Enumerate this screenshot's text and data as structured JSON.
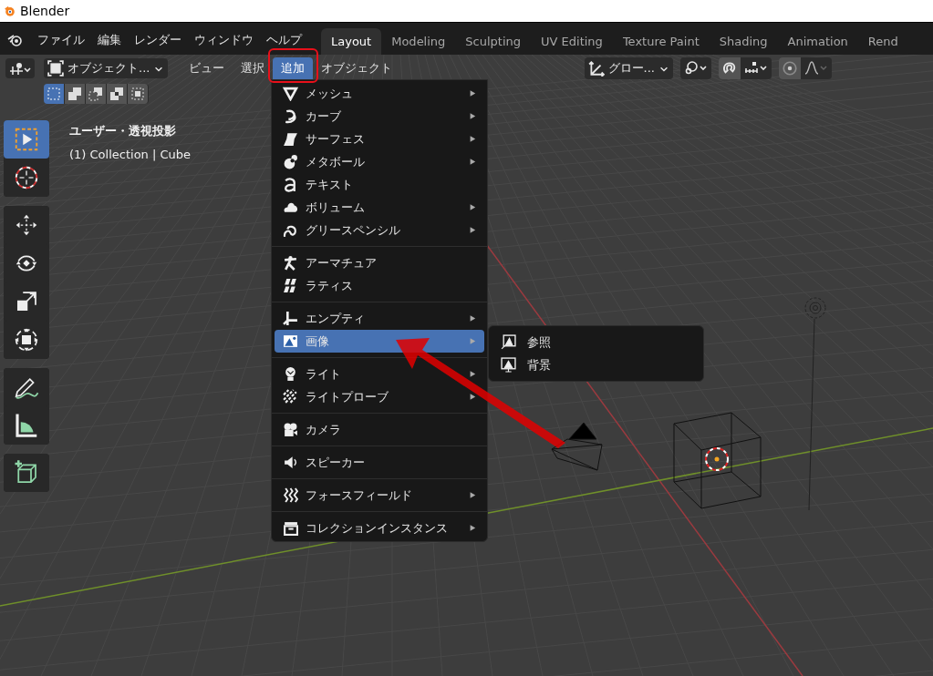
{
  "window": {
    "title": "Blender"
  },
  "top_menu": [
    "ファイル",
    "編集",
    "レンダー",
    "ウィンドウ",
    "ヘルプ"
  ],
  "workspace_tabs": [
    {
      "label": "Layout",
      "selected": true
    },
    {
      "label": "Modeling",
      "selected": false
    },
    {
      "label": "Sculpting",
      "selected": false
    },
    {
      "label": "UV Editing",
      "selected": false
    },
    {
      "label": "Texture Paint",
      "selected": false
    },
    {
      "label": "Shading",
      "selected": false
    },
    {
      "label": "Animation",
      "selected": false
    },
    {
      "label": "Rend",
      "selected": false
    }
  ],
  "header": {
    "mode_dropdown": "オブジェクト...",
    "menus": [
      {
        "label": "ビュー",
        "selected": false
      },
      {
        "label": "選択",
        "selected": false
      },
      {
        "label": "追加",
        "selected": true
      },
      {
        "label": "オブジェクト",
        "selected": false
      }
    ],
    "orientation_dropdown": "グロー..."
  },
  "select_modes": [
    {
      "selected": true
    },
    {
      "selected": false
    },
    {
      "selected": false
    },
    {
      "selected": false
    },
    {
      "selected": false
    }
  ],
  "toolbar": [
    [
      {
        "selected": true
      },
      {
        "selected": false
      }
    ],
    [
      {
        "selected": false
      },
      {
        "selected": false
      },
      {
        "selected": false
      },
      {
        "selected": false
      }
    ],
    [
      {
        "selected": false
      },
      {
        "selected": false
      }
    ],
    [
      {
        "selected": false
      }
    ]
  ],
  "viewport_info": [
    "ユーザー・透視投影",
    "(1) Collection | Cube"
  ],
  "add_menu": [
    [
      {
        "label": "メッシュ",
        "submenu": true,
        "selected": false
      },
      {
        "label": "カーブ",
        "submenu": true,
        "selected": false
      },
      {
        "label": "サーフェス",
        "submenu": true,
        "selected": false
      },
      {
        "label": "メタボール",
        "submenu": true,
        "selected": false
      },
      {
        "label": "テキスト",
        "submenu": false,
        "selected": false
      },
      {
        "label": "ボリューム",
        "submenu": true,
        "selected": false
      },
      {
        "label": "グリースペンシル",
        "submenu": true,
        "selected": false
      }
    ],
    [
      {
        "label": "アーマチュア",
        "submenu": false,
        "selected": false
      },
      {
        "label": "ラティス",
        "submenu": false,
        "selected": false
      }
    ],
    [
      {
        "label": "エンプティ",
        "submenu": true,
        "selected": false
      },
      {
        "label": "画像",
        "submenu": true,
        "selected": true
      }
    ],
    [
      {
        "label": "ライト",
        "submenu": true,
        "selected": false
      },
      {
        "label": "ライトプローブ",
        "submenu": true,
        "selected": false
      }
    ],
    [
      {
        "label": "カメラ",
        "submenu": false,
        "selected": false
      }
    ],
    [
      {
        "label": "スピーカー",
        "submenu": false,
        "selected": false
      }
    ],
    [
      {
        "label": "フォースフィールド",
        "submenu": true,
        "selected": false
      }
    ],
    [
      {
        "label": "コレクションインスタンス",
        "submenu": true,
        "selected": false
      }
    ]
  ],
  "image_submenu": [
    {
      "label": "参照"
    },
    {
      "label": "背景"
    }
  ]
}
